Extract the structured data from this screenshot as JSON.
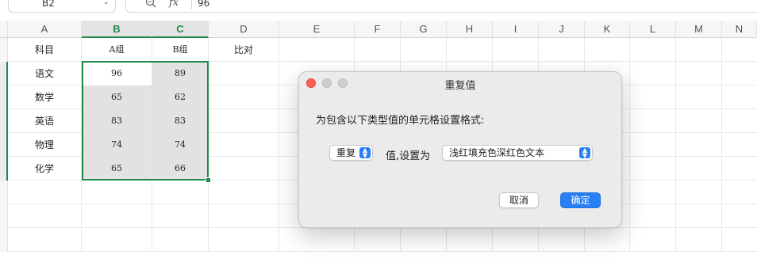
{
  "formula_bar": {
    "cell_ref": "B2",
    "fx_label": "fx",
    "value": "96"
  },
  "columns": [
    "A",
    "B",
    "C",
    "D",
    "E",
    "F",
    "G",
    "H",
    "I",
    "J",
    "K",
    "L",
    "M",
    "N"
  ],
  "table": {
    "headers": [
      "科目",
      "A组",
      "B组",
      "比对"
    ],
    "rows": [
      {
        "subject": "语文",
        "a": "96",
        "b": "89"
      },
      {
        "subject": "数学",
        "a": "65",
        "b": "62"
      },
      {
        "subject": "英语",
        "a": "83",
        "b": "83"
      },
      {
        "subject": "物理",
        "a": "74",
        "b": "74"
      },
      {
        "subject": "化学",
        "a": "65",
        "b": "66"
      }
    ]
  },
  "dialog": {
    "title": "重复值",
    "prompt": "为包含以下类型值的单元格设置格式:",
    "type_value": "重复",
    "set_to_label": "值,设置为",
    "format_value": "浅红填充色深红色文本",
    "cancel_label": "取消",
    "ok_label": "确定"
  },
  "colors": {
    "selection": "#1f8a4c",
    "accent": "#2b7ff5",
    "close_button": "#fe5f57"
  }
}
